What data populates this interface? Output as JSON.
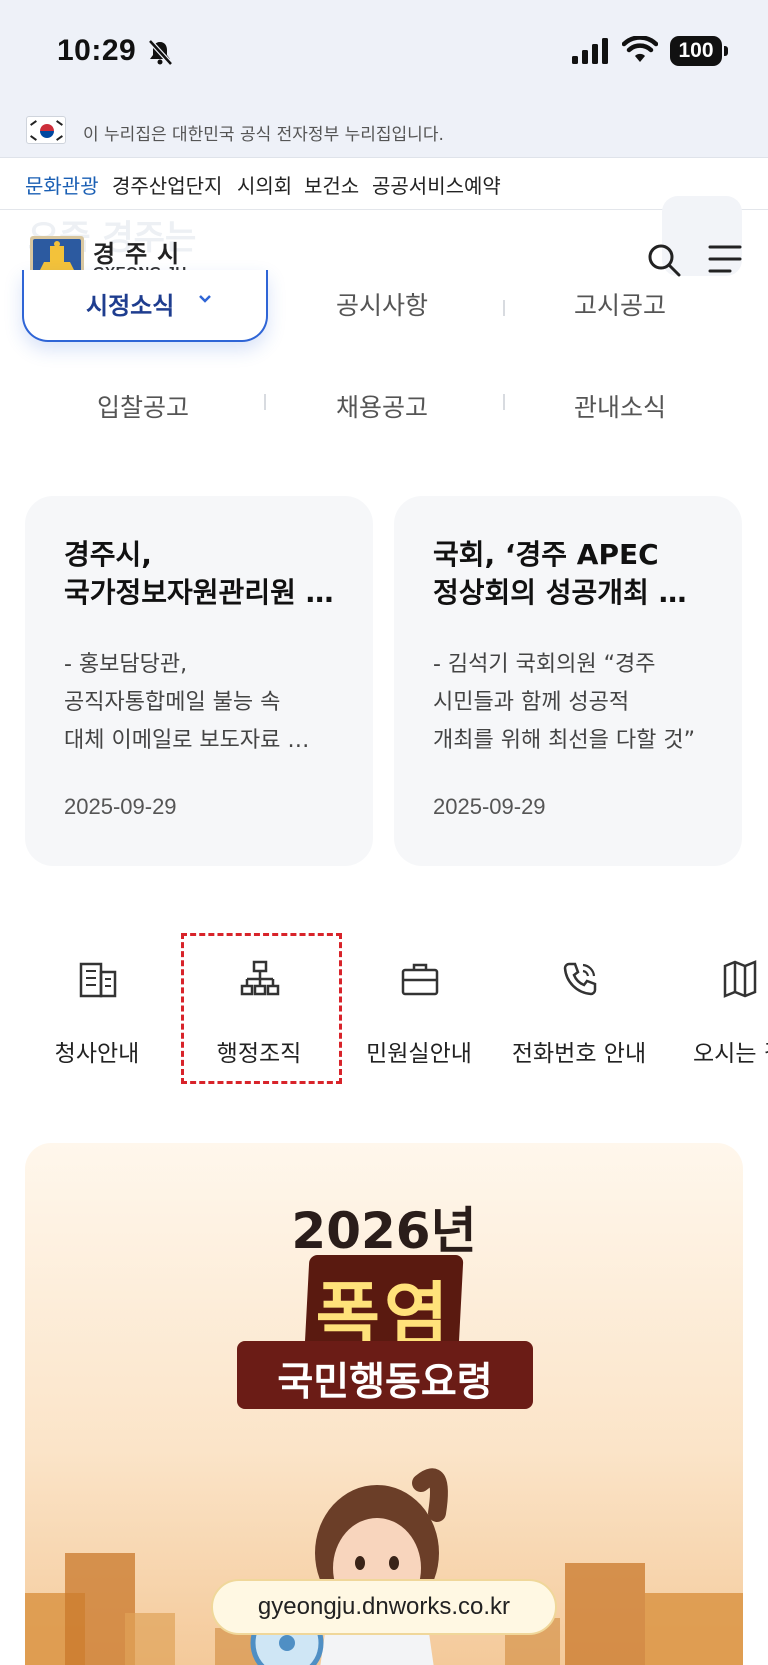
{
  "status_bar": {
    "time": "10:29",
    "battery": "100"
  },
  "gov_banner": {
    "text": "이 누리집은 대한민국 공식 전자정부 누리집입니다."
  },
  "quick_links": [
    "문화관광",
    "경주산업단지",
    "시의회",
    "보건소",
    "공공서비스예약"
  ],
  "header": {
    "ghost_title": "요즘 경주는",
    "logo_kr": "경주시",
    "logo_en": "GYEONG JU"
  },
  "news_tabs": {
    "active": "시정소식",
    "row1": [
      "공시사항",
      "고시공고"
    ],
    "row2": [
      "입찰공고",
      "채용공고",
      "관내소식"
    ]
  },
  "news_cards": [
    {
      "title_lines": [
        "경주시,",
        "국가정보자원관리원 화재"
      ],
      "summary_lines": [
        "- 홍보담당관,",
        "공직자통합메일 불능 속",
        "대체 이메일로 보도자료 배포"
      ],
      "date": "2025-09-29"
    },
    {
      "title_lines": [
        "국회, ‘경주 APEC",
        "정상회의 성공개최 결의안’"
      ],
      "summary_lines": [
        "- 김석기 국회의원 “경주",
        "시민들과 함께 성공적",
        "개최를 위해 최선을 다할 것”"
      ],
      "date": "2025-09-29"
    }
  ],
  "quick_menu": [
    {
      "label": "청사안내",
      "icon": "building-icon"
    },
    {
      "label": "행정조직",
      "icon": "org-chart-icon"
    },
    {
      "label": "민원실안내",
      "icon": "briefcase-icon"
    },
    {
      "label": "전화번호 안내",
      "icon": "phone-icon"
    },
    {
      "label": "오시는 길",
      "icon": "map-icon"
    }
  ],
  "promo": {
    "year": "2026년",
    "word": "폭염",
    "subtitle": "국민행동요령",
    "url": "gyeongju.dnworks.co.kr"
  },
  "colors": {
    "accent": "#2f65d6",
    "link_active": "#1a5fb4",
    "highlight": "#d8232a",
    "promo_dark": "#6b1c16"
  }
}
